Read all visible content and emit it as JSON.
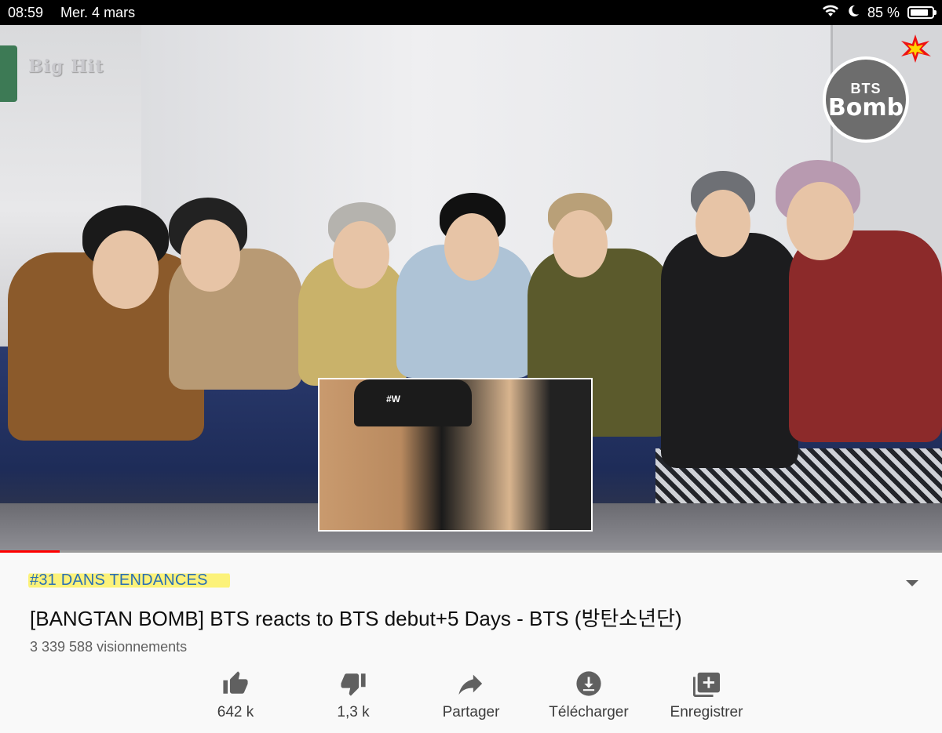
{
  "status_bar": {
    "time": "08:59",
    "date": "Mer. 4 mars",
    "battery": "85 %",
    "battery_level": 0.85
  },
  "video": {
    "watermark_left": "Big Hit",
    "watermark_right_top": "BTS",
    "watermark_right_main": "Bomb",
    "inset_cap_text": "#W",
    "progress": 0.063
  },
  "info": {
    "trending": "#31 DANS TENDANCES",
    "title": "[BANGTAN BOMB] BTS reacts to BTS debut+5 Days  - BTS (방탄소년단)",
    "views": "3 339 588 visionnements"
  },
  "actions": [
    {
      "icon": "thumb-up-icon",
      "label": "642 k"
    },
    {
      "icon": "thumb-down-icon",
      "label": "1,3 k"
    },
    {
      "icon": "share-icon",
      "label": "Partager"
    },
    {
      "icon": "download-icon",
      "label": "Télécharger"
    },
    {
      "icon": "playlist-add-icon",
      "label": "Enregistrer"
    }
  ],
  "colors": {
    "accent": "#ff0000",
    "trending_text": "#2a6fb5",
    "highlight": "#fcf27a"
  }
}
